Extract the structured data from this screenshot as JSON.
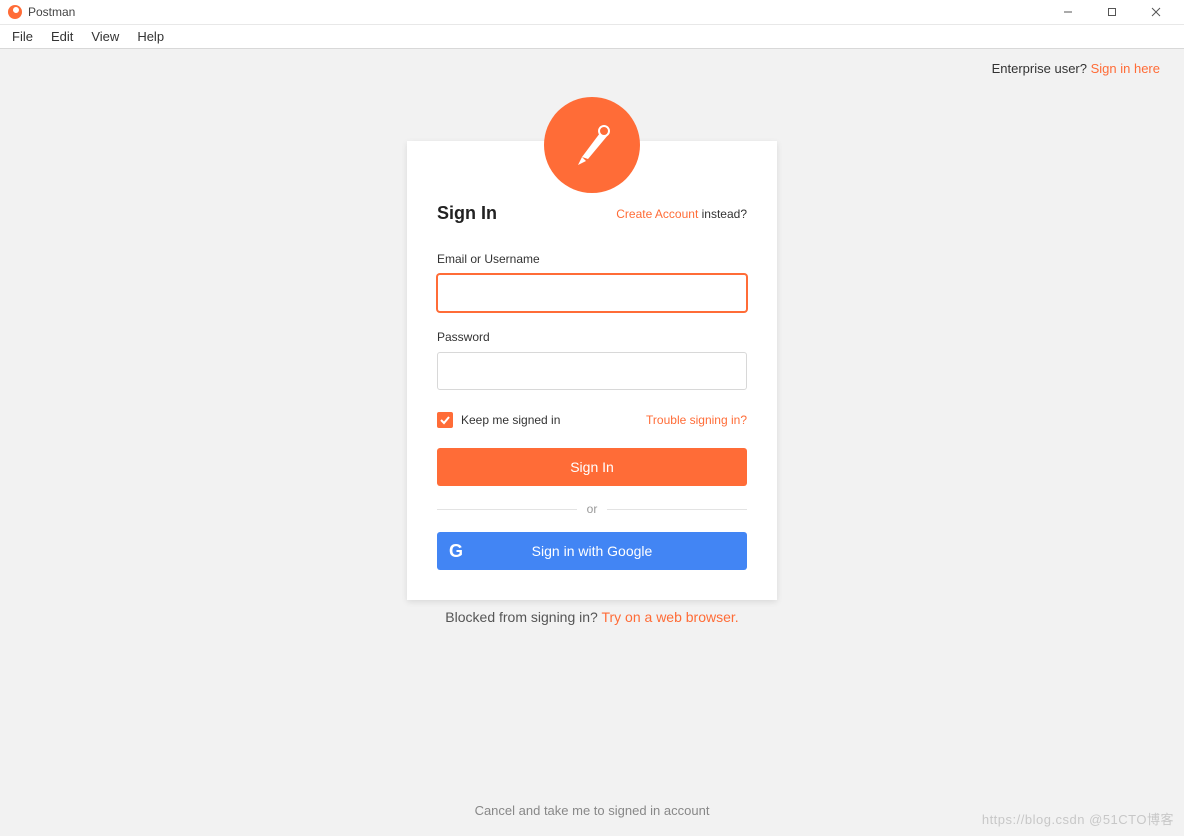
{
  "window": {
    "title": "Postman"
  },
  "menu": {
    "file": "File",
    "edit": "Edit",
    "view": "View",
    "help": "Help"
  },
  "enterprise": {
    "prompt": "Enterprise user? ",
    "link": "Sign in here"
  },
  "card": {
    "heading": "Sign In",
    "create_link": "Create Account",
    "create_suffix": " instead?",
    "email_label": "Email or Username",
    "password_label": "Password",
    "keep_signed_label": "Keep me signed in",
    "trouble_link": "Trouble signing in?",
    "signin_button": "Sign In",
    "or_text": "or",
    "google_button": "Sign in with Google"
  },
  "blocked": {
    "prefix": "Blocked from signing in? ",
    "link": "Try on a web browser."
  },
  "footer": {
    "cancel": "Cancel and take me to signed in account"
  },
  "watermark": "https://blog.csdn @51CTO博客",
  "colors": {
    "accent": "#ff6c37",
    "google": "#4285f4"
  }
}
